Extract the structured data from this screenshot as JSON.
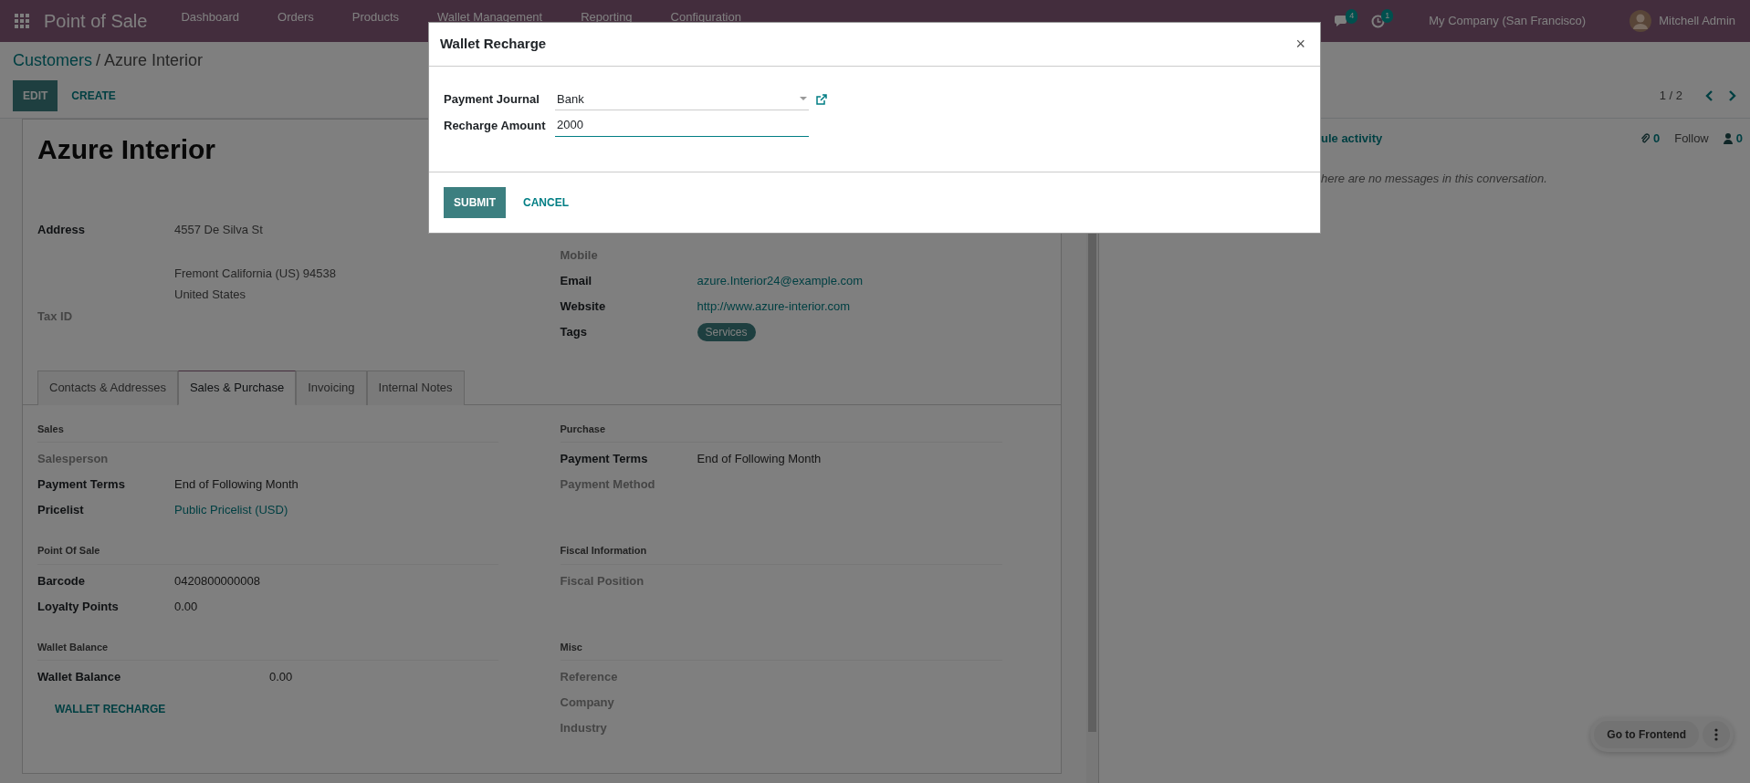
{
  "navbar": {
    "app_name": "Point of Sale",
    "menu": [
      "Dashboard",
      "Orders",
      "Products",
      "Wallet Management",
      "Reporting",
      "Configuration"
    ],
    "messages_count": "4",
    "activities_count": "1",
    "company": "My Company (San Francisco)",
    "user": "Mitchell Admin"
  },
  "breadcrumb": {
    "parent": "Customers",
    "separator": "/",
    "current": "Azure Interior"
  },
  "actions": [
    {
      "label": "EDIT",
      "kind": "primary"
    },
    {
      "label": "CREATE",
      "kind": "link"
    }
  ],
  "pager": "1 / 2",
  "record": {
    "title": "Azure Interior",
    "address": {
      "label": "Address",
      "lines": [
        "4557 De Silva St",
        "Fremont  California (US)  94538",
        "United States"
      ]
    },
    "left_fields": [
      {
        "label": "Tax ID"
      }
    ],
    "right_fields": [
      {
        "label": "Mobile"
      },
      {
        "label": "Email",
        "value": "azure.Interior24@example.com",
        "kind": "link"
      },
      {
        "label": "Website",
        "value": "http://www.azure-interior.com",
        "kind": "link"
      },
      {
        "label": "Tags",
        "value": "Services",
        "kind": "tag"
      }
    ],
    "tabs": [
      {
        "label": "Contacts & Addresses",
        "selected": false
      },
      {
        "label": "Sales & Purchase",
        "selected": true
      },
      {
        "label": "Invoicing",
        "selected": false
      },
      {
        "label": "Internal Notes",
        "selected": false
      }
    ],
    "group_rows": [
      [
        {
          "title": "Sales",
          "fields": [
            {
              "label": "Salesperson"
            },
            {
              "label": "Payment Terms",
              "value": "End of Following Month",
              "kind": "text"
            },
            {
              "label": "Pricelist",
              "value": "Public Pricelist (USD)",
              "kind": "link"
            }
          ]
        },
        {
          "title": "Purchase",
          "fields": [
            {
              "label": "Payment Terms",
              "value": "End of Following Month",
              "kind": "text"
            },
            {
              "label": "Payment Method"
            }
          ]
        }
      ],
      [
        {
          "title": "Point Of Sale",
          "fields": [
            {
              "label": "Barcode",
              "value": "0420800000008",
              "kind": "text"
            },
            {
              "label": "Loyalty Points",
              "value": "0.00",
              "kind": "text"
            }
          ]
        },
        {
          "title": "Fiscal Information",
          "fields": [
            {
              "label": "Fiscal Position"
            }
          ]
        }
      ],
      [
        {
          "title": "Wallet Balance",
          "fields": [
            {
              "label": "Wallet Balance",
              "value": "0.00",
              "kind": "amount"
            }
          ],
          "button": "WALLET RECHARGE"
        },
        {
          "title": "Misc",
          "fields": [
            {
              "label": "Reference"
            },
            {
              "label": "Company"
            },
            {
              "label": "Industry"
            }
          ]
        }
      ]
    ]
  },
  "chatter": {
    "activity": "ule activity",
    "attachments": "0",
    "follow": "Follow",
    "followers": "0",
    "empty_message": "here are no messages in this conversation."
  },
  "floating": {
    "label": "Go to Frontend"
  },
  "dialog": {
    "title": "Wallet Recharge",
    "close": "×",
    "fields": [
      {
        "label": "Payment Journal",
        "value": "Bank",
        "kind": "select"
      },
      {
        "label": "Recharge Amount",
        "value": "2000",
        "kind": "input"
      }
    ],
    "buttons": [
      {
        "label": "SUBMIT",
        "kind": "primary"
      },
      {
        "label": "CANCEL",
        "kind": "link"
      }
    ]
  }
}
